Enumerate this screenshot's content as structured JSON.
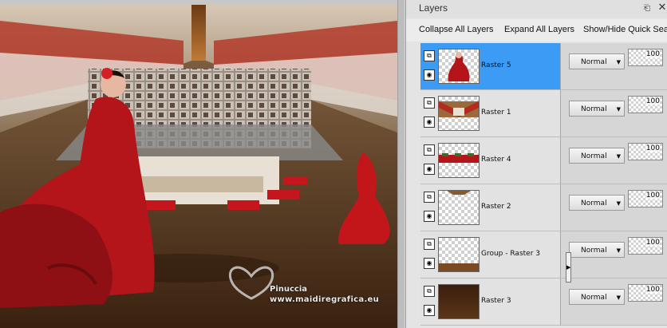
{
  "panel": {
    "title": "Layers",
    "menu_icon": "panel-menu-icon",
    "close_icon": "close-icon"
  },
  "toolbar": {
    "collapse_label": "Collapse All Layers",
    "expand_label": "Expand All Layers",
    "showhide_label": "Show/Hide Quick Sea"
  },
  "layers": [
    {
      "name": "Raster 5",
      "blend": "Normal",
      "opacity": "100",
      "selected": true,
      "thumb": "dancer"
    },
    {
      "name": "Raster 1",
      "blend": "Normal",
      "opacity": "100",
      "selected": false,
      "thumb": "scene"
    },
    {
      "name": "Raster 4",
      "blend": "Normal",
      "opacity": "100",
      "selected": false,
      "thumb": "tables"
    },
    {
      "name": "Raster 2",
      "blend": "Normal",
      "opacity": "100",
      "selected": false,
      "thumb": "edge"
    },
    {
      "name": "Group - Raster 3",
      "blend": "Normal",
      "opacity": "100",
      "selected": false,
      "thumb": "floor"
    },
    {
      "name": "Raster 3",
      "blend": "Normal",
      "opacity": "100",
      "selected": false,
      "thumb": "brown"
    }
  ],
  "watermark": {
    "name": "Pinuccia",
    "url": "www.maidiregrafica.eu"
  },
  "colors": {
    "selection": "#3c9cf5",
    "brown": "#5b3518"
  }
}
